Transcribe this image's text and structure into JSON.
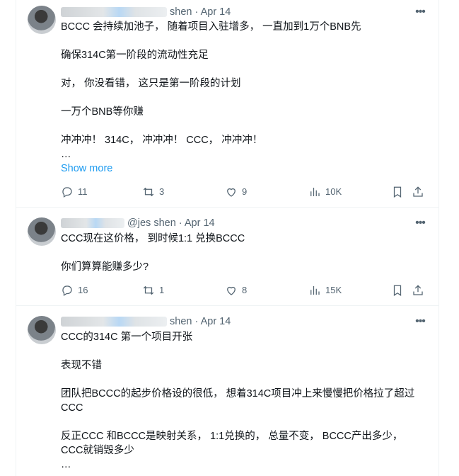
{
  "timestamp_sep": "·",
  "tweets": [
    {
      "name_suffix": "shen",
      "date": "Apr 14",
      "more_label": "•••",
      "paragraphs": [
        "BCCC 会持续加池子， 随着项目入驻增多， 一直加到1万个BNB先",
        "确保314C第一阶段的流动性充足",
        "对， 你没看错， 这只是第一阶段的计划",
        "一万个BNB等你赚",
        "冲冲冲！ 314C， 冲冲冲！ CCC， 冲冲冲！\n…"
      ],
      "show_more": "Show more",
      "replies": "11",
      "reposts": "3",
      "likes": "9",
      "views": "10K"
    },
    {
      "name_suffix": "@jes   shen",
      "date": "Apr 14",
      "more_label": "•••",
      "paragraphs": [
        "CCC现在这价格， 到时候1:1 兑换BCCC",
        "你们算算能赚多少?"
      ],
      "replies": "16",
      "reposts": "1",
      "likes": "8",
      "views": "15K"
    },
    {
      "name_suffix": "shen",
      "date": "Apr 14",
      "more_label": "•••",
      "paragraphs": [
        "CCC的314C 第一个项目开张",
        "表现不错",
        "团队把BCCC的起步价格设的很低， 想着314C项目冲上来慢慢把价格拉了超过CCC",
        "反正CCC 和BCCC是映射关系， 1:1兑换的， 总量不变， BCCC产出多少，CCC就销毁多少\n…"
      ]
    }
  ]
}
